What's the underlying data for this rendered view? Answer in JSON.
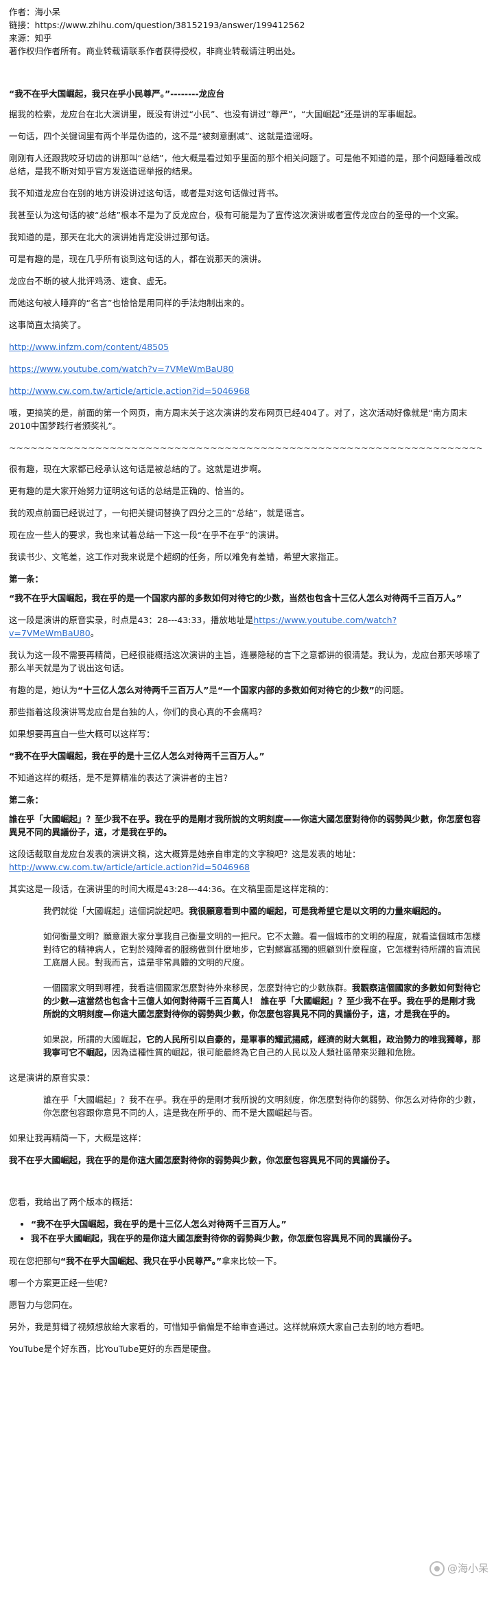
{
  "meta": {
    "author": "作者：海小呆",
    "link_prefix": "链接：",
    "link_url": "https://www.zhihu.com/question/38152193/answer/199412562",
    "source": "来源：知乎",
    "copyright": "著作权归作者所有。商业转载请联系作者获得授权，非商业转载请注明出处。"
  },
  "title": "“我不在乎大国崛起，我只在乎小民尊严。”--------龙应台",
  "intro": [
    "据我的检索，龙应台在北大演讲里，既没有讲过“小民”、也没有讲过“尊严”，“大国崛起”还是讲的军事崛起。",
    "一句话，四个关键词里有两个半是伪造的，这不是“被刻意删减”、这就是造谣呀。",
    "刚刚有人还跟我咬牙切齿的讲那叫“总结”，他大概是看过知乎里面的那个相关问题了。可是他不知道的是，那个问题睡着改成总结，是我不断对知乎官方发送造谣举报的结果。",
    "我不知道龙应台在别的地方讲没讲过这句话，或者是对这句话做过背书。",
    "我甚至认为这句话的被“总结”根本不是为了反龙应台，极有可能是为了宣传这次演讲或者宣传龙应台的圣母的一个文案。",
    "我知道的是，那天在北大的演讲她肯定没讲过那句话。",
    "可是有趣的是，现在几乎所有谈到这句话的人，都在说那天的演讲。",
    "龙应台不断的被人批评鸡汤、速食、虚无。",
    "而她这句被人睡弃的“名言”也恰恰是用同样的手法炮制出来的。",
    "这事简直太搞笑了。"
  ],
  "links": [
    "http://www.infzm.com/content/48505",
    "https://www.youtube.com/watch?v=7VMeWmBaU80",
    "http://www.cw.com.tw/article/article.action?id=5046968"
  ],
  "after_links": "哦，更搞笑的是，前面的第一个网页，南方周末关于这次演讲的发布网页已经404了。对了，这次活动好像就是“南方周末2010中国梦践行者颁奖礼”。",
  "divider": "~~~~~~~~~~~~~~~~~~~~~~~~~~~~~~~~~~~~~~~~~~~~~~~~~~~~~~~~~~~~~~~~~~~~~~~~~~~~~~~~~",
  "part2": [
    "很有趣，现在大家都已经承认这句话是被总结的了。这就是进步啊。",
    "更有趣的是大家开始努力证明这句话的总结是正确的、恰当的。",
    "我的观点前面已经说过了，一句把关键词替换了四分之三的“总结”，就是谣言。",
    "现在应一些人的要求，我也来试着总结一下这一段“在乎不在乎”的演讲。",
    "我读书少、文笔差，这工作对我来说是个超纲的任务，所以难免有差错，希望大家指正。"
  ],
  "section1": {
    "heading": "第一条：",
    "quote": "“我不在乎大国崛起，我在乎的是一个国家内部的多数如何对待它的少数，当然也包含十三亿人怎么对待两千三百万人。”",
    "source_prefix": "这一段是演讲的原音实录，时点是43：28---43:33，播放地址是",
    "source_link": "https://www.youtube.com/watch?v=7VMeWmBaU80",
    "source_suffix": "。",
    "p1": "我认为这一段不需要再精简，已经很能概括这次演讲的主旨，连暴隐秘的言下之意都讲的很清楚。我认为，龙应台那天哆嗦了那么半天就是为了说出这句话。",
    "p2_prefix": "有趣的是，她认为",
    "p2_bold1": "“十三亿人怎么对待两千三百万人”",
    "p2_mid": "是",
    "p2_bold2": "“一个国家内部的多数如何对待它的少数”",
    "p2_suffix": "的问题。",
    "p3": "那些指着这段演讲骂龙应台是台独的人，你们的良心真的不会痛吗？",
    "p4": "如果想要再直白一些大概可以这样写：",
    "summary": "“我不在乎大国崛起，我在乎的是十三亿人怎么对待两千三百万人。”",
    "p5": "不知道这样的概括，是不是算精准的表达了演讲者的主旨？"
  },
  "section2": {
    "heading": "第二条：",
    "quote": "誰在乎「大國崛起」？至少我不在乎。我在乎的是剛才我所說的文明刻度——你這大國怎麼對待你的弱勢與少數，你怎麼包容異見不同的異議份子，這，才是我在乎的。",
    "source_prefix": "这段话截取自龙应台发表的演讲文稿，这大概算是她亲自审定的文字稿吧？这是发表的地址：",
    "source_link": "http://www.cw.com.tw/article/article.action?id=5046968",
    "p1": "其实这是一段话，在演讲里的时间大概是43:28---44:36。在文稿里面是这样定稿的：",
    "block": [
      {
        "normal": "我們就從「大國崛起」這個詞說起吧。",
        "bold": "我很願意看到中國的崛起，可是我希望它是以文明的力量來崛起的。",
        "tail": ""
      },
      {
        "normal": "如何衡量文明？願意跟大家分享我自己衡量文明的一把尺。它不太難。看一個城市的文明的程度，就看這個城市怎樣對待它的精神病人，它對於殘障者的服務做到什麼地步，它對鰥寡孤獨的照顧到什麼程度，它怎樣對待所謂的盲流民工底層人民。對我而言，這是非常具體的文明的尺度。",
        "bold": "",
        "tail": ""
      },
      {
        "normal": "一個國家文明到哪裡，我看這個國家怎麼對待外來移民，怎麼對待它的少數族群。",
        "bold": "我觀察這個國家的多數如何對待它的少數—這當然也包含十三億人如何對待兩千三百萬人！ 誰在乎「大國崛起」？至少我不在乎。我在乎的是剛才我所說的文明刻度—你這大國怎麼對待你的弱勢與少數，你怎麼包容異見不同的異議份子，這，才是我在乎的。",
        "tail": ""
      },
      {
        "normal": "如果說，所謂的大國崛起，",
        "bold": "它的人民所引以自豪的，是軍事的耀武揚威，經濟的財大氣粗，政治勢力的唯我獨尊，那我寧可它不崛起，",
        "tail": "因為這種性質的崛起，很可能最終為它自己的人民以及人類社區帶來災難和危險。"
      }
    ],
    "p2": "这是演讲的原音实录：",
    "audio_quote": "誰在乎「大國崛起」？我不在乎。我在乎的是剛才我所說的文明刻度，你怎麼對待你的弱勢、你怎么对待你的少數，你怎麼包容跟你意見不同的人，這是我在所乎的、而不是大國崛起与否。",
    "p3": "如果让我再精简一下，大概是这样：",
    "summary": "我不在乎大國崛起，我在乎的是你這大國怎麼對待你的弱勢與少數，你怎麼包容異見不同的異議份子。"
  },
  "conclusion": {
    "p1": "您看，我给出了两个版本的概括：",
    "bullets": [
      "“我不在乎大国崛起，我在乎的是十三亿人怎么对待两千三百万人。”",
      "我不在乎大國崛起，我在乎的是你這大國怎麼對待你的弱勢與少數，你怎麼包容異見不同的異議份子。"
    ],
    "p2_prefix": "现在您把那句",
    "p2_bold": "“我不在乎大国崛起、我只在乎小民尊严。”",
    "p2_suffix": "拿来比较一下。",
    "p3": "哪一个方案更正经一些呢？",
    "p4": "愿智力与您同在。",
    "p5": "另外，我是剪辑了视频想放给大家看的，可惜知乎偏偏是不给审查通过。这样就麻烦大家自己去别的地方看吧。",
    "p6": "YouTube是个好东西，比YouTube更好的东西是硬盘。"
  },
  "watermark": "@海小呆"
}
